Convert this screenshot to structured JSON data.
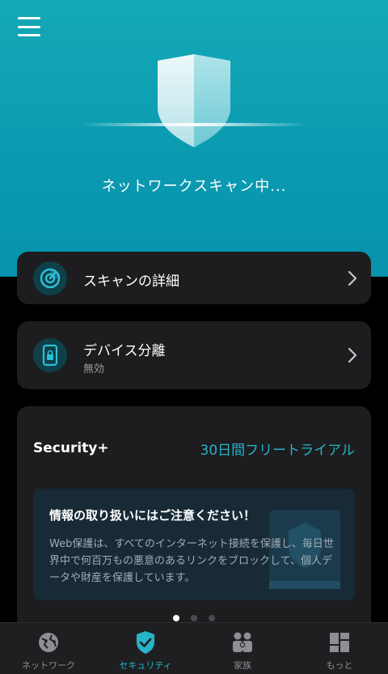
{
  "hero": {
    "status_text": "ネットワークスキャン中..."
  },
  "cards": {
    "scan_details": {
      "title": "スキャンの詳細"
    },
    "device_isolation": {
      "title": "デバイス分離",
      "subtitle": "無効"
    }
  },
  "security_plus": {
    "title": "Security+",
    "trial_link": "30日間フリートライアル",
    "info_heading": "情報の取り扱いにはご注意ください！",
    "info_body": "Web保護は、すべてのインターネット接続を保護し、毎日世界中で何百万もの悪意のあるリンクをブロックして、個人データや財産を保護しています。"
  },
  "pagination": {
    "total": 3,
    "active_index": 0
  },
  "tabbar": {
    "tabs": [
      {
        "label": "ネットワーク",
        "icon": "globe-icon",
        "active": false
      },
      {
        "label": "セキュリティ",
        "icon": "shield-check-icon",
        "active": true
      },
      {
        "label": "家族",
        "icon": "family-icon",
        "active": false
      },
      {
        "label": "もっと",
        "icon": "grid-icon",
        "active": false
      }
    ]
  },
  "colors": {
    "hero_gradient_top": "#14a9b6",
    "hero_gradient_bottom": "#0792ad",
    "accent": "#27b3c8",
    "card_bg": "#1d1d1f",
    "background": "#000000"
  }
}
